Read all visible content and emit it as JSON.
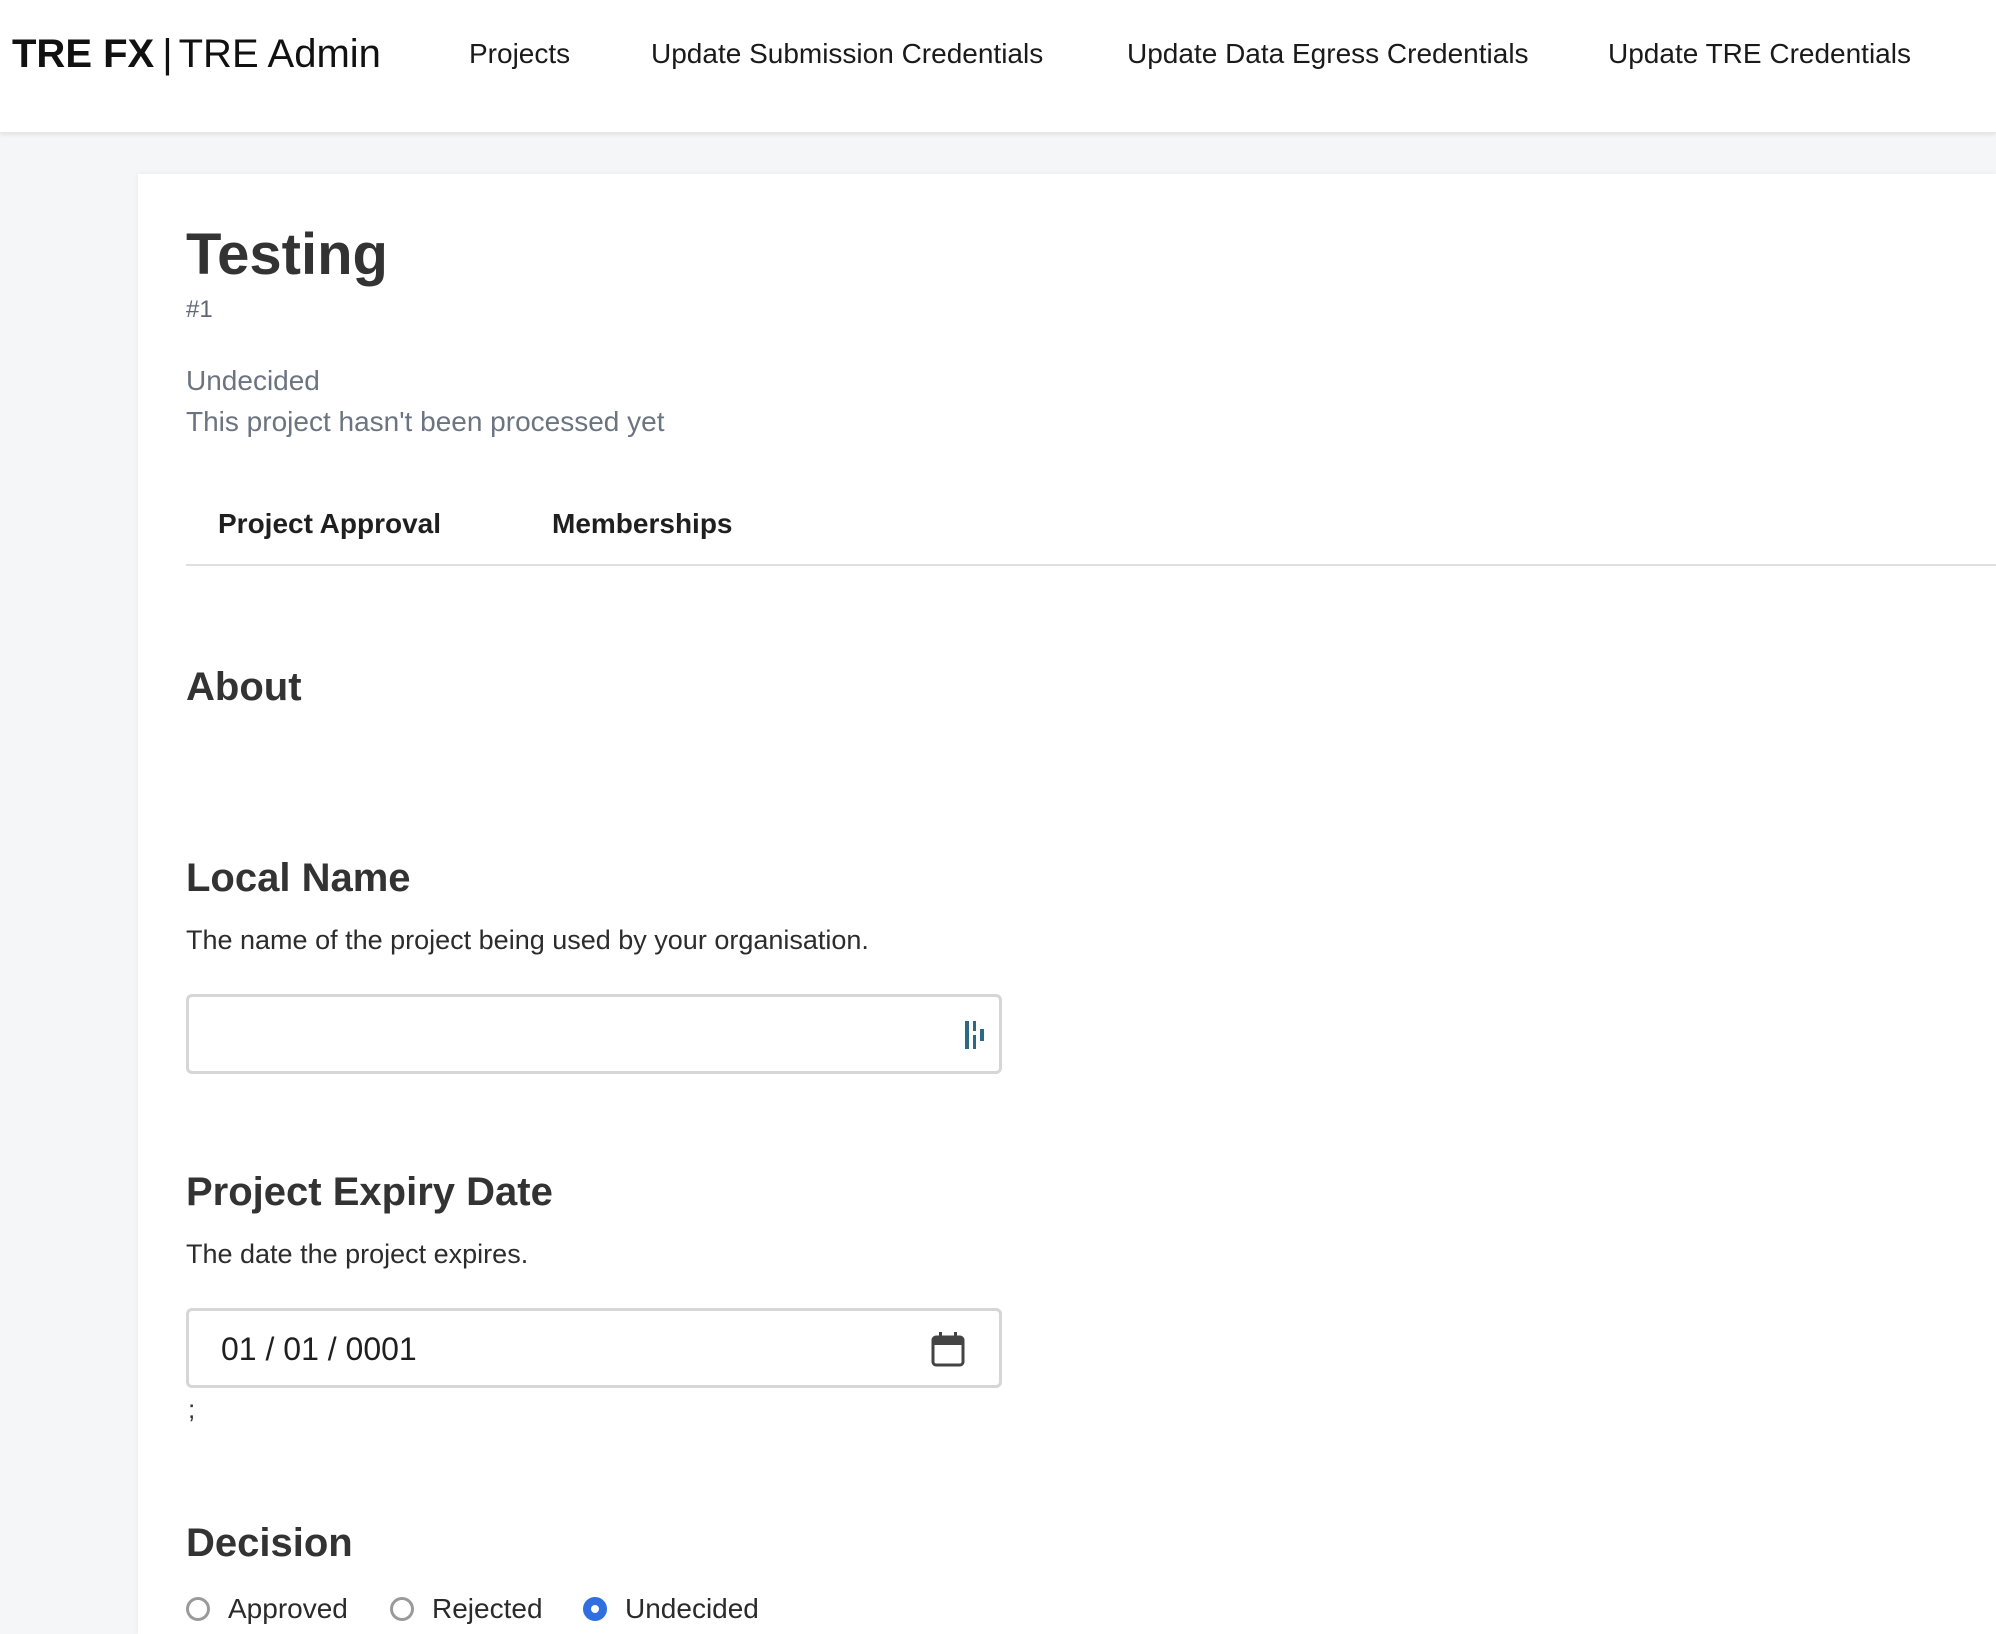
{
  "brand": {
    "name": "TRE FX",
    "separator": "|",
    "subtitle": "TRE Admin"
  },
  "nav": {
    "projects": "Projects",
    "submission_credentials": "Update Submission Credentials",
    "egress_credentials": "Update Data Egress Credentials",
    "tre_credentials": "Update TRE Credentials"
  },
  "project": {
    "title": "Testing",
    "id": "#1",
    "status": "Undecided",
    "status_description": "This project hasn't been processed yet"
  },
  "tabs": {
    "approval": "Project Approval",
    "memberships": "Memberships"
  },
  "about": {
    "heading": "About"
  },
  "local_name": {
    "heading": "Local Name",
    "description": "The name of the project being used by your organisation.",
    "value": ""
  },
  "expiry": {
    "heading": "Project Expiry Date",
    "description": "The date the project expires.",
    "value": "01 / 01 / 0001",
    "trailing": ";"
  },
  "decision": {
    "heading": "Decision",
    "options": [
      "Approved",
      "Rejected",
      "Undecided"
    ],
    "selected": "Undecided"
  },
  "colors": {
    "accent": "#2f6fe0",
    "muted_text": "#6b7480",
    "page_bg": "#f5f6f8"
  },
  "icons": {
    "input_icon": "password-manager-icon",
    "date_icon": "calendar-icon"
  }
}
